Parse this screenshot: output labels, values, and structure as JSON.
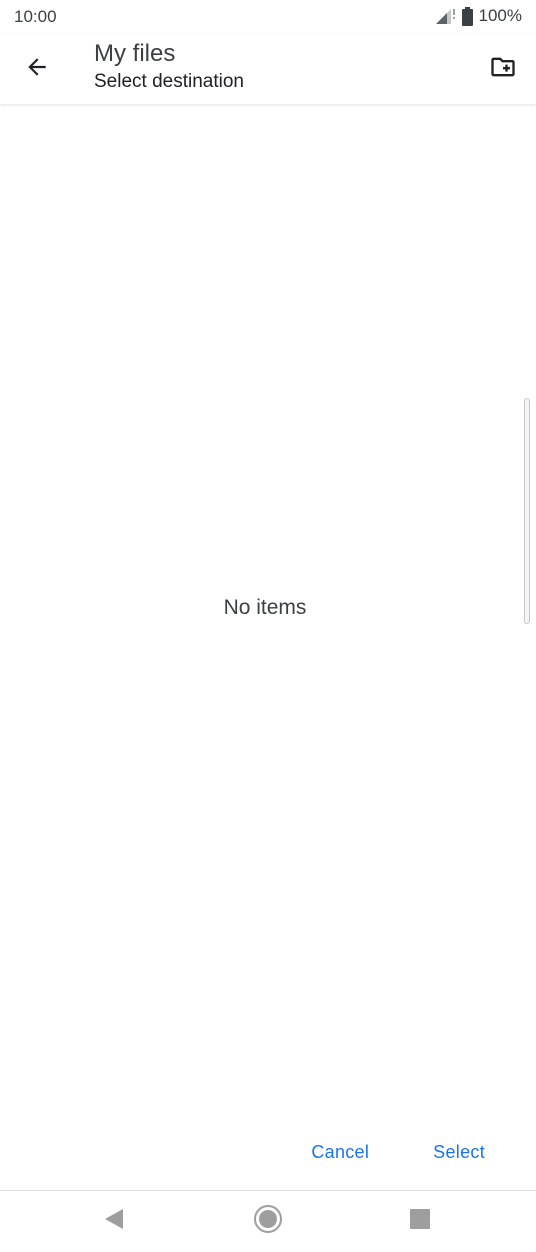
{
  "status_bar": {
    "time": "10:00",
    "battery": "100%"
  },
  "app_bar": {
    "title": "My files",
    "subtitle": "Select destination"
  },
  "content": {
    "empty_message": "No items"
  },
  "actions": {
    "cancel_label": "Cancel",
    "select_label": "Select"
  },
  "icons": {
    "back": "arrow-back-icon",
    "new_folder": "create-new-folder-icon",
    "signal": "signal-icon",
    "battery": "battery-icon",
    "nav_back": "nav-back-icon",
    "nav_home": "nav-home-icon",
    "nav_recents": "nav-recents-icon"
  },
  "colors": {
    "accent": "#1a73e8",
    "text_primary": "#202124",
    "text_secondary": "#3c4043"
  }
}
